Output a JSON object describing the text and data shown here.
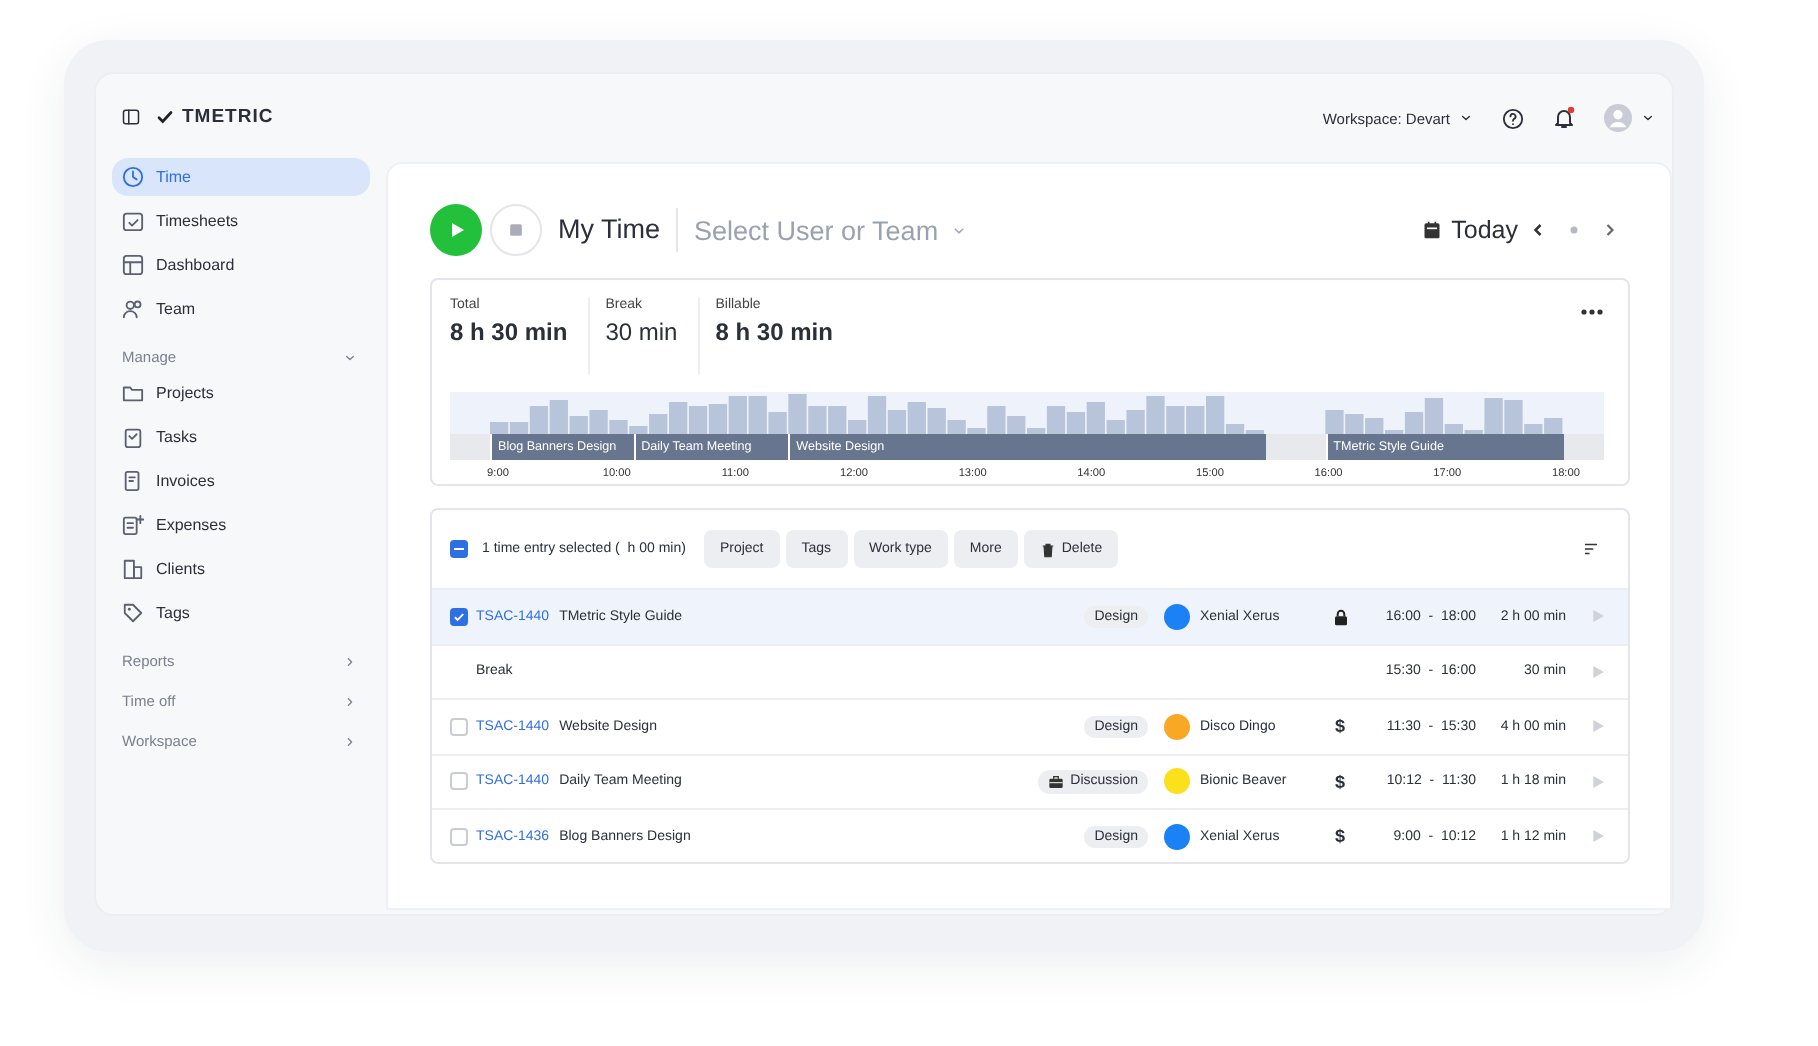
{
  "app": {
    "logo": "TMETRIC",
    "workspace": "Workspace: Devart",
    "unread_notifications": true
  },
  "sidebar": {
    "items": [
      {
        "label": "Time",
        "selected": true
      },
      {
        "label": "Timesheets",
        "selected": false
      },
      {
        "label": "Dashboard",
        "selected": false
      },
      {
        "label": "Team",
        "selected": false
      }
    ],
    "sections": [
      {
        "label": "Manage",
        "expanded": true,
        "children": [
          {
            "label": "Projects",
            "selected": false
          },
          {
            "label": "Tasks",
            "selected": false
          },
          {
            "label": "Invoices",
            "selected": false
          },
          {
            "label": "Expenses",
            "selected": false
          },
          {
            "label": "Clients",
            "selected": false
          },
          {
            "label": "Tags",
            "selected": false
          }
        ]
      },
      {
        "label": "Reports",
        "expanded": false
      },
      {
        "label": "Time off",
        "expanded": false
      },
      {
        "label": "Workspace",
        "expanded": false
      }
    ]
  },
  "toolbar": {
    "title": "My Time",
    "user_select": {
      "placeholder": "Select User or Team"
    },
    "date": "Today"
  },
  "summary": {
    "stats": [
      {
        "label": "Total",
        "value": "8 h 30 min",
        "bold": true
      },
      {
        "label": "Break",
        "value": "30 min",
        "bold": false
      },
      {
        "label": "Billable",
        "value": "8 h 30 min",
        "bold": true
      }
    ],
    "timeline": {
      "segments": [
        {
          "label": "Blog Banners Design"
        },
        {
          "label": "Daily Team Meeting"
        },
        {
          "label": "Website Design"
        },
        {
          "label": "TMetric Style Guide"
        }
      ],
      "ticks": [
        "9:00",
        "10:00",
        "11:00",
        "12:00",
        "13:00",
        "14:00",
        "15:00",
        "16:00",
        "17:00",
        "18:00"
      ]
    }
  },
  "entries": {
    "selection": {
      "indeterminate": true,
      "text": "1 time entry selected (  h 00 min)"
    },
    "actions": [
      "Project",
      "Tags",
      "Work type",
      "More",
      "Delete"
    ],
    "rows": [
      {
        "kind": "entry",
        "checked": true,
        "selected": true,
        "task_id": "TSAC-1440",
        "title": "TMetric Style Guide",
        "tag": {
          "label": "Design",
          "briefcase": false
        },
        "user": {
          "name": "Xenial Xerus",
          "color": "#1a82f5"
        },
        "locked": true,
        "billing": "",
        "time": "16:00  -  18:00",
        "duration": "2 h 00 min"
      },
      {
        "kind": "break",
        "selected": false,
        "title": "Break",
        "time": "15:30  -  16:00",
        "duration": "30 min"
      },
      {
        "kind": "entry",
        "checked": false,
        "selected": false,
        "task_id": "TSAC-1440",
        "title": "Website Design",
        "tag": {
          "label": "Design",
          "briefcase": false
        },
        "user": {
          "name": "Disco Dingo",
          "color": "#f9a825"
        },
        "locked": false,
        "billing": "$",
        "time": "11:30  -  15:30",
        "duration": "4 h 00 min"
      },
      {
        "kind": "entry",
        "checked": false,
        "selected": false,
        "task_id": "TSAC-1440",
        "title": "Daily Team Meeting",
        "tag": {
          "label": "Discussion",
          "briefcase": true
        },
        "user": {
          "name": "Bionic Beaver",
          "color": "#fbe01c"
        },
        "locked": false,
        "billing": "$",
        "time": "10:12  -  11:30",
        "duration": "1 h 18 min"
      },
      {
        "kind": "entry",
        "checked": false,
        "selected": false,
        "task_id": "TSAC-1436",
        "title": "Blog Banners Design",
        "tag": {
          "label": "Design",
          "briefcase": false
        },
        "user": {
          "name": "Xenial Xerus",
          "color": "#1a82f5"
        },
        "locked": false,
        "billing": "$",
        "time": "9:00  -  10:12",
        "duration": "1 h 12 min"
      }
    ]
  }
}
